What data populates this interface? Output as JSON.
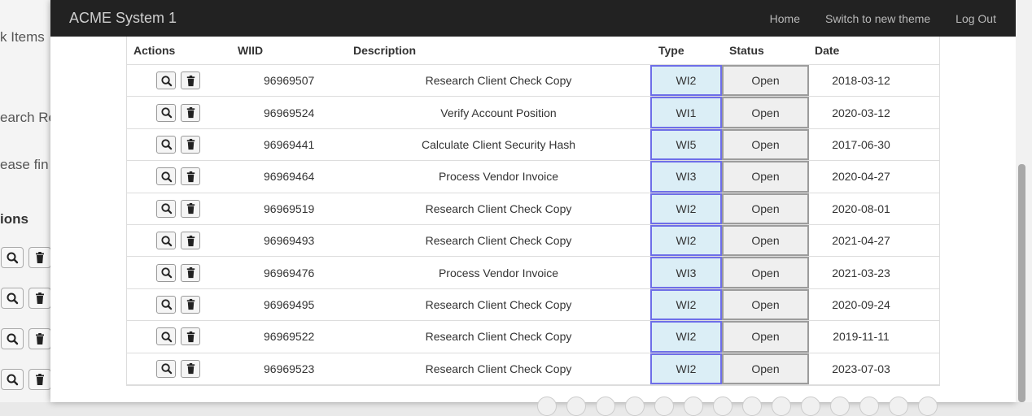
{
  "background": {
    "fragments": [
      "k Items",
      "earch Re",
      "ease fin",
      "ions"
    ]
  },
  "navbar": {
    "brand": "ACME System 1",
    "links": [
      "Home",
      "Switch to new theme",
      "Log Out"
    ]
  },
  "table": {
    "headers": [
      "Actions",
      "WIID",
      "Description",
      "Type",
      "Status",
      "Date"
    ],
    "rows": [
      {
        "wiid": "96969507",
        "description": "Research Client Check Copy",
        "type": "WI2",
        "status": "Open",
        "date": "2018-03-12"
      },
      {
        "wiid": "96969524",
        "description": "Verify Account Position",
        "type": "WI1",
        "status": "Open",
        "date": "2020-03-12"
      },
      {
        "wiid": "96969441",
        "description": "Calculate Client Security Hash",
        "type": "WI5",
        "status": "Open",
        "date": "2017-06-30"
      },
      {
        "wiid": "96969464",
        "description": "Process Vendor Invoice",
        "type": "WI3",
        "status": "Open",
        "date": "2020-04-27"
      },
      {
        "wiid": "96969519",
        "description": "Research Client Check Copy",
        "type": "WI2",
        "status": "Open",
        "date": "2020-08-01"
      },
      {
        "wiid": "96969493",
        "description": "Research Client Check Copy",
        "type": "WI2",
        "status": "Open",
        "date": "2021-04-27"
      },
      {
        "wiid": "96969476",
        "description": "Process Vendor Invoice",
        "type": "WI3",
        "status": "Open",
        "date": "2021-03-23"
      },
      {
        "wiid": "96969495",
        "description": "Research Client Check Copy",
        "type": "WI2",
        "status": "Open",
        "date": "2020-09-24"
      },
      {
        "wiid": "96969522",
        "description": "Research Client Check Copy",
        "type": "WI2",
        "status": "Open",
        "date": "2019-11-11"
      },
      {
        "wiid": "96969523",
        "description": "Research Client Check Copy",
        "type": "WI2",
        "status": "Open",
        "date": "2023-07-03"
      }
    ]
  },
  "icons": {
    "view": "magnifier-icon",
    "delete": "trash-icon"
  },
  "colors": {
    "navbar_bg": "#222222",
    "type_cell_bg": "#dbeef6",
    "type_cell_border": "#6e6ee8",
    "status_cell_bg": "#efefef",
    "status_cell_border": "#9c9c9c"
  }
}
